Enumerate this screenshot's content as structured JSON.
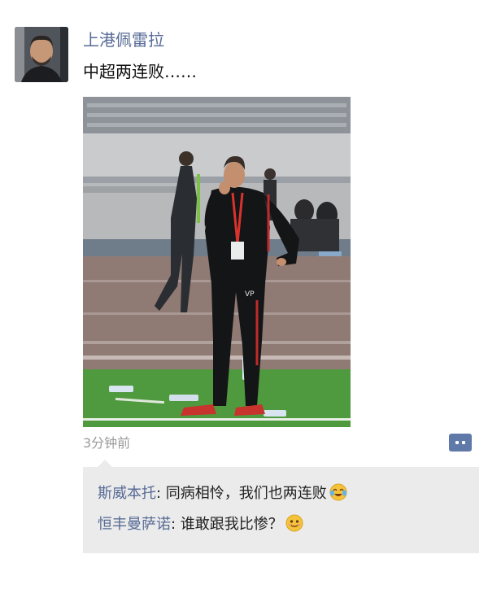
{
  "post": {
    "author": "上港佩雷拉",
    "text": "中超两连败……",
    "time": "3分钟前"
  },
  "photo": {
    "shirt_initials": "VP"
  },
  "comments": [
    {
      "author": "斯威本托",
      "separator": ": ",
      "text": "同病相怜，我们也两连败",
      "emoji": "laughing-tears-emoji"
    },
    {
      "author": "恒丰曼萨诺",
      "separator": ": ",
      "text": "谁敢跟我比惨？",
      "emoji": "smile-emoji"
    }
  ],
  "colors": {
    "link": "#576b95",
    "comment_bg": "#ebebeb",
    "more_button": "#5f7aa8"
  }
}
